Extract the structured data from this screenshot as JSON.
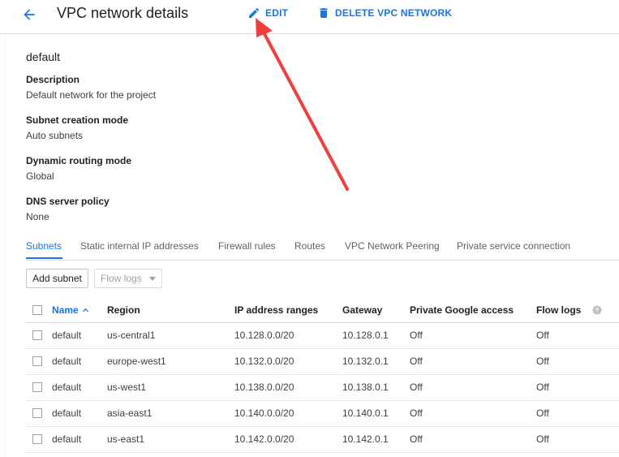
{
  "header": {
    "title": "VPC network details",
    "edit_label": "EDIT",
    "delete_label": "DELETE VPC NETWORK"
  },
  "network": {
    "name": "default",
    "properties": [
      {
        "label": "Description",
        "value": "Default network for the project"
      },
      {
        "label": "Subnet creation mode",
        "value": "Auto subnets"
      },
      {
        "label": "Dynamic routing mode",
        "value": "Global"
      },
      {
        "label": "DNS server policy",
        "value": "None"
      }
    ]
  },
  "tabs": [
    {
      "label": "Subnets",
      "active": true
    },
    {
      "label": "Static internal IP addresses",
      "active": false
    },
    {
      "label": "Firewall rules",
      "active": false
    },
    {
      "label": "Routes",
      "active": false
    },
    {
      "label": "VPC Network Peering",
      "active": false
    },
    {
      "label": "Private service connection",
      "active": false
    }
  ],
  "toolbar": {
    "add_subnet_label": "Add subnet",
    "flow_logs_placeholder": "Flow logs"
  },
  "table": {
    "columns": [
      "Name",
      "Region",
      "IP address ranges",
      "Gateway",
      "Private Google access",
      "Flow logs"
    ],
    "sorted_column": "Name",
    "rows": [
      {
        "name": "default",
        "region": "us-central1",
        "ip_range": "10.128.0.0/20",
        "gateway": "10.128.0.1",
        "private_access": "Off",
        "flow_logs": "Off"
      },
      {
        "name": "default",
        "region": "europe-west1",
        "ip_range": "10.132.0.0/20",
        "gateway": "10.132.0.1",
        "private_access": "Off",
        "flow_logs": "Off"
      },
      {
        "name": "default",
        "region": "us-west1",
        "ip_range": "10.138.0.0/20",
        "gateway": "10.138.0.1",
        "private_access": "Off",
        "flow_logs": "Off"
      },
      {
        "name": "default",
        "region": "asia-east1",
        "ip_range": "10.140.0.0/20",
        "gateway": "10.140.0.1",
        "private_access": "Off",
        "flow_logs": "Off"
      },
      {
        "name": "default",
        "region": "us-east1",
        "ip_range": "10.142.0.0/20",
        "gateway": "10.142.0.1",
        "private_access": "Off",
        "flow_logs": "Off"
      }
    ]
  },
  "colors": {
    "accent": "#1a73e8",
    "annotation_arrow": "#ee3e3e"
  },
  "icons": {
    "back": "arrow-back-icon",
    "edit": "pencil-icon",
    "delete": "trash-icon",
    "sort": "arrow-up-icon",
    "help": "help-circle-icon"
  }
}
